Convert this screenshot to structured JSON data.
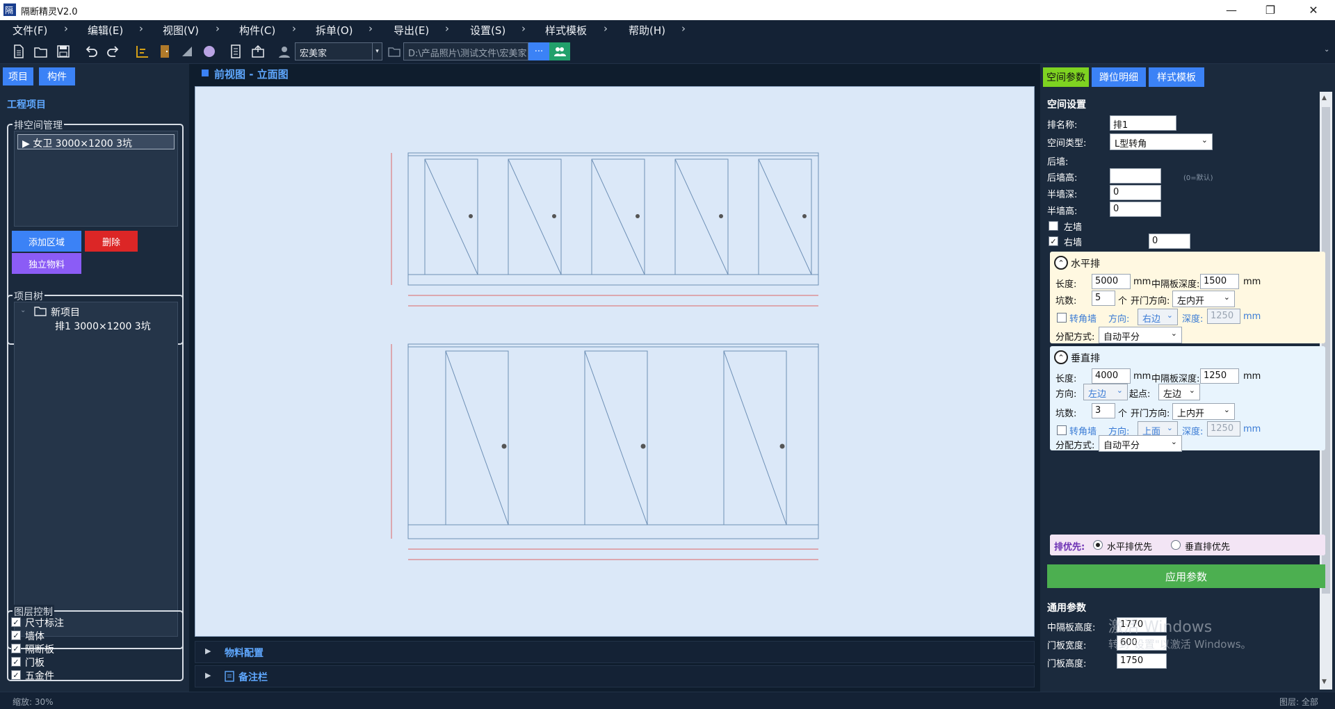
{
  "window": {
    "title": "隔断精灵V2.0",
    "minimize": "—",
    "maximize": "❐",
    "close": "✕"
  },
  "menu": [
    "文件(F)",
    "编辑(E)",
    "视图(V)",
    "构件(C)",
    "拆单(O)",
    "导出(E)",
    "设置(S)",
    "样式模板",
    "帮助(H)"
  ],
  "toolbar": {
    "user_value": "宏美家",
    "path_value": "D:\\产品照片\\测试文件\\宏美家",
    "more_label": "···"
  },
  "left": {
    "tabs": [
      "项目",
      "构件"
    ],
    "section_title": "工程项目",
    "space_group_title": "排空间管理",
    "space_item": "▶ 女卫  3000×1200 3坑",
    "add_area": "添加区域",
    "delete": "删除",
    "independent_material": "独立物料",
    "tree_group_title": "项目树",
    "tree_root": "新项目",
    "tree_child": "排1  3000×1200  3坑",
    "layer_group_title": "图层控制",
    "layers": [
      "尺寸标注",
      "墙体",
      "隔断板",
      "门板",
      "五金件"
    ]
  },
  "center": {
    "view_title": "前视图 - 立面图",
    "material_config": "物料配置",
    "notes_bar": "备注栏"
  },
  "right": {
    "tabs": [
      "空间参数",
      "蹲位明细",
      "样式模板"
    ],
    "space_settings": "空间设置",
    "row_name_label": "排名称:",
    "row_name_value": "排1",
    "space_type_label": "空间类型:",
    "space_type_value": "L型转角",
    "back_wall_label": "后墙:",
    "back_wall_height_label": "后墙高:",
    "back_wall_height_value": "",
    "back_wall_hint": "(0=默认)",
    "half_wall_depth_label": "半墙深:",
    "half_wall_depth_value": "0",
    "half_wall_height_label": "半墙高:",
    "half_wall_height_value": "0",
    "left_wall_label": "左墙",
    "right_wall_label": "右墙",
    "right_wall_value": "0",
    "horizontal": {
      "title": "水平排",
      "length_label": "长度:",
      "length_value": "5000",
      "mm": "mm",
      "mid_depth_label": "中隔板深度:",
      "mid_depth_value": "1500",
      "count_label": "坑数:",
      "count_value": "5",
      "unit": "个",
      "door_dir_label": "开门方向:",
      "door_dir_value": "左内开",
      "corner_wall_label": "转角墙",
      "dir_label": "方向:",
      "dir_value": "右边",
      "depth_label": "深度:",
      "depth_value": "1250",
      "dist_label": "分配方式:",
      "dist_value": "自动平分"
    },
    "vertical": {
      "title": "垂直排",
      "length_label": "长度:",
      "length_value": "4000",
      "mm": "mm",
      "mid_depth_label": "中隔板深度:",
      "mid_depth_value": "1250",
      "dir_label": "方向:",
      "dir_value": "左边",
      "start_label": "起点:",
      "start_value": "左边",
      "count_label": "坑数:",
      "count_value": "3",
      "unit": "个",
      "door_dir_label": "开门方向:",
      "door_dir_value": "上内开",
      "corner_wall_label": "转角墙",
      "corner_dir_label": "方向:",
      "corner_dir_value": "上面",
      "depth_label": "深度:",
      "depth_value": "1250",
      "dist_label": "分配方式:",
      "dist_value": "自动平分"
    },
    "priority_label": "排优先:",
    "priority_h": "水平排优先",
    "priority_v": "垂直排优先",
    "apply_button": "应用参数",
    "general_params": "通用参数",
    "mid_panel_height_label": "中隔板高度:",
    "mid_panel_height_value": "1770",
    "door_width_label": "门板宽度:",
    "door_width_value": "600",
    "door_height_label": "门板高度:",
    "door_height_value": "1750",
    "watermark_1": "激活 Windows",
    "watermark_2": "转到\"设置\"以激活 Windows。"
  },
  "status": {
    "zoom": "缩放: 30%",
    "layer": "图层: 全部"
  },
  "colors": {
    "accent_blue": "#3b82f6",
    "danger_red": "#dc2626",
    "purple": "#8b5cf6",
    "green": "#4caf50",
    "tab_green": "#7ed321"
  }
}
